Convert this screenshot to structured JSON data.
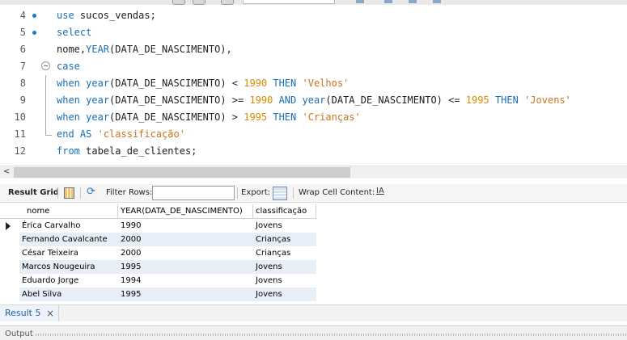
{
  "editor": {
    "lines": [
      {
        "n": "4",
        "tokens": [
          [
            "kw",
            "use"
          ],
          [
            "",
            " sucos_vendas;"
          ]
        ]
      },
      {
        "n": "5",
        "tokens": [
          [
            "kw",
            "select"
          ]
        ]
      },
      {
        "n": "6",
        "tokens": [
          [
            "",
            "nome,"
          ],
          [
            "fn",
            "YEAR"
          ],
          [
            "",
            "(DATA_DE_NASCIMENTO),"
          ]
        ]
      },
      {
        "n": "7",
        "tokens": [
          [
            "kw",
            "case"
          ]
        ]
      },
      {
        "n": "8",
        "tokens": [
          [
            "kw",
            "when"
          ],
          [
            "",
            ""
          ],
          [
            "fn",
            "year"
          ],
          [
            "",
            "(DATA_DE_NASCIMENTO) < "
          ],
          [
            "num",
            "1990"
          ],
          [
            "",
            ""
          ],
          [
            "kw",
            "THEN"
          ],
          [
            "",
            ""
          ],
          [
            "str",
            "'Velhos'"
          ]
        ]
      },
      {
        "n": "9",
        "tokens": [
          [
            "kw",
            "when"
          ],
          [
            "",
            ""
          ],
          [
            "fn",
            "year"
          ],
          [
            "",
            "(DATA_DE_NASCIMENTO) >= "
          ],
          [
            "num",
            "1990"
          ],
          [
            "",
            ""
          ],
          [
            "kw",
            "AND"
          ],
          [
            "",
            ""
          ],
          [
            "fn",
            "year"
          ],
          [
            "",
            "(DATA_DE_NASCIMENTO) <= "
          ],
          [
            "num",
            "1995"
          ],
          [
            "",
            ""
          ],
          [
            "kw",
            "THEN"
          ],
          [
            "",
            ""
          ],
          [
            "str",
            "'Jovens'"
          ]
        ]
      },
      {
        "n": "10",
        "tokens": [
          [
            "kw",
            "when"
          ],
          [
            "",
            ""
          ],
          [
            "fn",
            "year"
          ],
          [
            "",
            "(DATA_DE_NASCIMENTO) > "
          ],
          [
            "num",
            "1995"
          ],
          [
            "",
            ""
          ],
          [
            "kw",
            "THEN"
          ],
          [
            "",
            ""
          ],
          [
            "str",
            "'Crianças'"
          ]
        ]
      },
      {
        "n": "11",
        "tokens": [
          [
            "kw",
            "end"
          ],
          [
            "",
            ""
          ],
          [
            "kw",
            "AS"
          ],
          [
            "",
            ""
          ],
          [
            "str",
            "'classificação'"
          ]
        ]
      },
      {
        "n": "12",
        "tokens": [
          [
            "kw",
            "from"
          ],
          [
            "",
            " tabela_de_clientes;"
          ]
        ]
      }
    ]
  },
  "result_toolbar": {
    "result_grid_label": "Result Grid",
    "filter_rows_label": "Filter Rows:",
    "filter_rows_value": "",
    "export_label": "Export:",
    "wrap_label": "Wrap Cell Content:",
    "wrap_icon": "IA"
  },
  "grid": {
    "columns": [
      "nome",
      "YEAR(DATA_DE_NASCIMENTO)",
      "classificação"
    ],
    "rows": [
      [
        "Érica Carvalho",
        "1990",
        "Jovens"
      ],
      [
        "Fernando Cavalcante",
        "2000",
        "Crianças"
      ],
      [
        "César Teixeira",
        "2000",
        "Crianças"
      ],
      [
        "Marcos Nougeuira",
        "1995",
        "Jovens"
      ],
      [
        "Eduardo Jorge",
        "1994",
        "Jovens"
      ],
      [
        "Abel Silva",
        "1995",
        "Jovens"
      ]
    ]
  },
  "tabs": {
    "result_tab_label": "Result 5",
    "close_glyph": "×"
  },
  "output": {
    "label": "Output"
  },
  "colors": {
    "keyword": "#1a6eb3",
    "number": "#d98a00",
    "string": "#c8741a",
    "alt_row": "#e8eef8"
  }
}
